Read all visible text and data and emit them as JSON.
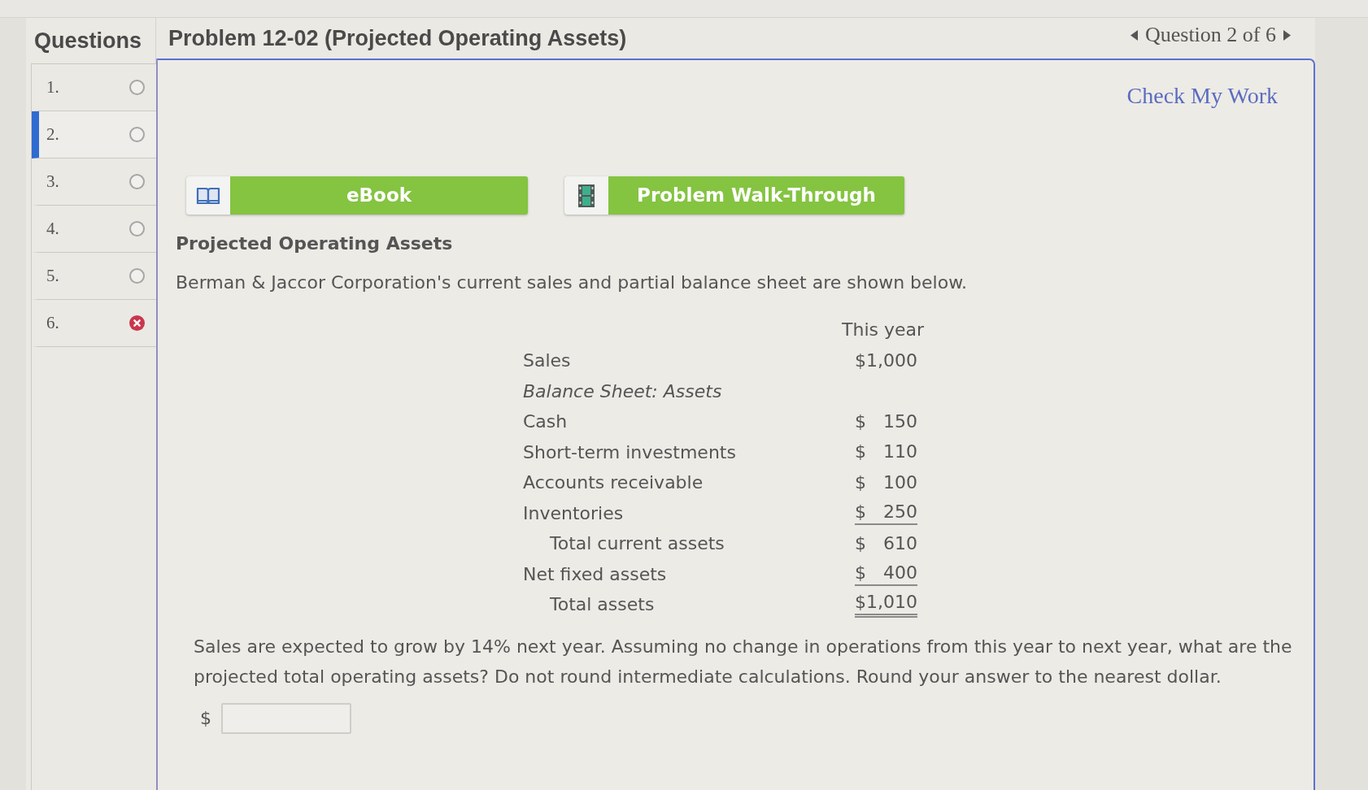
{
  "sidebar": {
    "title": "Questions",
    "questions": [
      {
        "number": "1.",
        "selected": false,
        "incorrect": false
      },
      {
        "number": "2.",
        "selected": true,
        "incorrect": false
      },
      {
        "number": "3.",
        "selected": false,
        "incorrect": false
      },
      {
        "number": "4.",
        "selected": false,
        "incorrect": false
      },
      {
        "number": "5.",
        "selected": false,
        "incorrect": false
      },
      {
        "number": "6.",
        "selected": false,
        "incorrect": true
      }
    ]
  },
  "header": {
    "title": "Problem 12-02 (Projected Operating Assets)",
    "nav": "Question 2 of 6"
  },
  "check_my_work": "Check My Work",
  "resources": [
    {
      "kind": "ebook",
      "label": "eBook"
    },
    {
      "kind": "video",
      "label": "Problem Walk-Through"
    }
  ],
  "problem": {
    "heading": "Projected Operating Assets",
    "intro": "Berman & Jaccor Corporation's current sales and partial balance sheet are shown below.",
    "table": {
      "column_header": "This year",
      "rows": [
        {
          "kind": "line",
          "label": "Sales",
          "amount": "$1,000"
        },
        {
          "kind": "heading",
          "label": "Balance Sheet: Assets"
        },
        {
          "kind": "line",
          "label": "Cash",
          "currency": "$",
          "amount": "150"
        },
        {
          "kind": "line",
          "label": "Short-term investments",
          "currency": "$",
          "amount": "110"
        },
        {
          "kind": "line",
          "label": "Accounts receivable",
          "currency": "$",
          "amount": "100"
        },
        {
          "kind": "ruled",
          "label": "Inventories",
          "currency": "$",
          "amount": "250"
        },
        {
          "kind": "subtotal",
          "label": "Total current assets",
          "currency": "$",
          "amount": "610"
        },
        {
          "kind": "ruled",
          "label": "Net fixed assets",
          "currency": "$",
          "amount": "400"
        },
        {
          "kind": "total",
          "label": "Total assets",
          "amount": "$1,010"
        }
      ]
    },
    "question": "Sales are expected to grow by 14% next year. Assuming no change in operations from this year to next year, what are the projected total operating assets? Do not round intermediate calculations. Round your answer to the nearest dollar.",
    "answer": {
      "prefix": "$"
    }
  }
}
